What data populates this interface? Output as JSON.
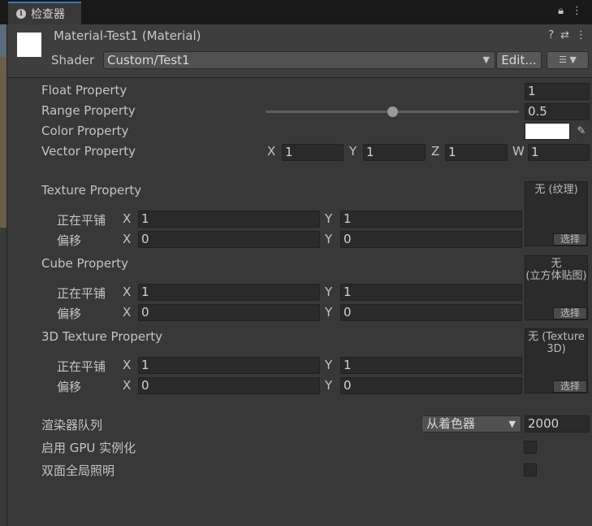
{
  "tab": {
    "title": "检查器"
  },
  "header": {
    "title": "Material-Test1 (Material)",
    "shader_label": "Shader",
    "shader_value": "Custom/Test1",
    "edit_label": "Edit..."
  },
  "props": {
    "float": {
      "label": "Float Property",
      "value": "1"
    },
    "range": {
      "label": "Range Property",
      "value": "0.5",
      "slider_fraction": 0.5
    },
    "color": {
      "label": "Color Property",
      "value": "#ffffff"
    },
    "vector": {
      "label": "Vector Property",
      "x": "1",
      "y": "1",
      "z": "1",
      "w": "1"
    }
  },
  "axes": {
    "x": "X",
    "y": "Y",
    "z": "Z",
    "w": "W"
  },
  "tiling_label": "正在平铺",
  "offset_label": "偏移",
  "select_label": "选择",
  "textures": [
    {
      "label": "Texture Property",
      "none_text": "无 (纹理)",
      "tiling_x": "1",
      "tiling_y": "1",
      "offset_x": "0",
      "offset_y": "0"
    },
    {
      "label": "Cube Property",
      "none_text": "无\n(立方体贴图)",
      "tiling_x": "1",
      "tiling_y": "1",
      "offset_x": "0",
      "offset_y": "0"
    },
    {
      "label": "3D Texture Property",
      "none_text": "无 (Texture\n3D)",
      "tiling_x": "1",
      "tiling_y": "1",
      "offset_x": "0",
      "offset_y": "0"
    }
  ],
  "render_queue": {
    "label": "渲染器队列",
    "mode": "从着色器",
    "value": "2000"
  },
  "gpu_instancing": {
    "label": "启用 GPU 实例化",
    "checked": false
  },
  "double_sided_gi": {
    "label": "双面全局照明",
    "checked": false
  }
}
